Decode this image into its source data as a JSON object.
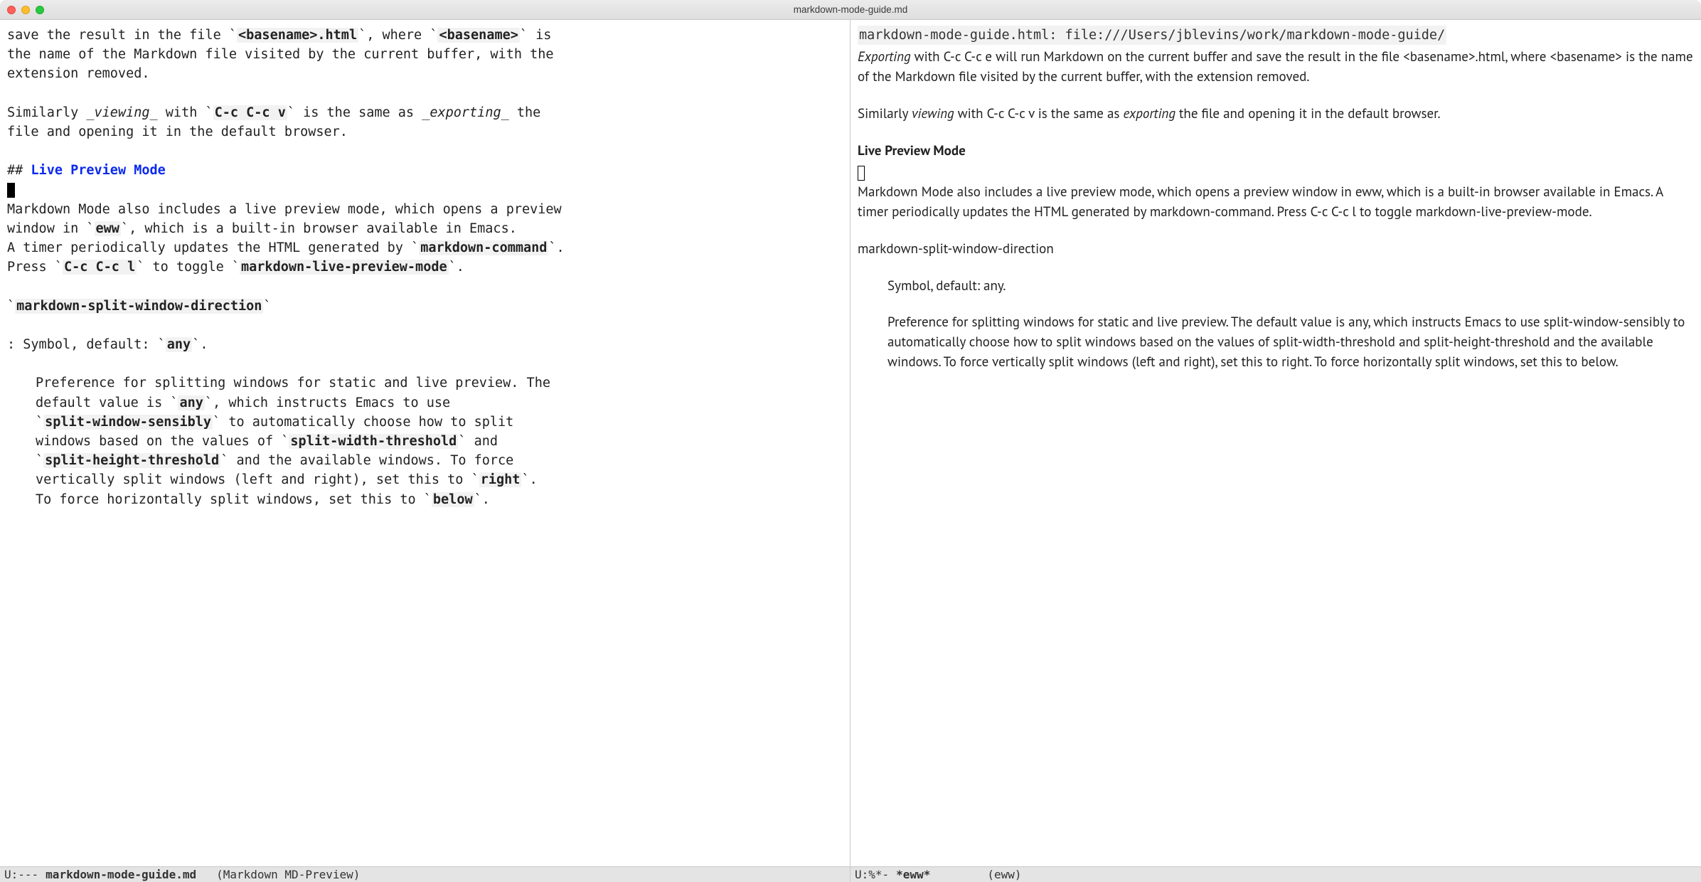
{
  "window": {
    "title": "markdown-mode-guide.md"
  },
  "left": {
    "line1_a": "save the result in the file `",
    "line1_b": "<basename>.html",
    "line1_c": "`, where `",
    "line1_d": "<basename>",
    "line1_e": "` is",
    "line2": "the name of the Markdown file visited by the current buffer, with the",
    "line3": "extension removed.",
    "line5_a": "Similarly ",
    "line5_b": "_viewing_",
    "line5_c": " with `",
    "line5_d": "C-c C-c v",
    "line5_e": "` is the same as ",
    "line5_f": "_exporting_",
    "line5_g": " the",
    "line6": "file and opening it in the default browser.",
    "line8_a": "## ",
    "line8_b": "Live Preview Mode",
    "line10": "Markdown Mode also includes a live preview mode, which opens a preview",
    "line11_a": "window in `",
    "line11_b": "eww",
    "line11_c": "`, which is a built-in browser available in Emacs.",
    "line12_a": "A timer periodically updates the HTML generated by `",
    "line12_b": "markdown-command",
    "line12_c": "`.",
    "line13_a": "Press `",
    "line13_b": "C-c C-c l",
    "line13_c": "` to toggle `",
    "line13_d": "markdown-live-preview-mode",
    "line13_e": "`.",
    "line15_a": "`",
    "line15_b": "markdown-split-window-direction",
    "line15_c": "`",
    "line17_a": ":   Symbol, default: `",
    "line17_b": "any",
    "line17_c": "`.",
    "line19": "Preference for splitting windows for static and live preview.  The",
    "line20_a": "default value is `",
    "line20_b": "any",
    "line20_c": "`, which instructs Emacs to use",
    "line21_a": "`",
    "line21_b": "split-window-sensibly",
    "line21_c": "` to automatically choose how to split",
    "line22_a": "windows based on the values of `",
    "line22_b": "split-width-threshold",
    "line22_c": "` and",
    "line23_a": "`",
    "line23_b": "split-height-threshold",
    "line23_c": "` and the available windows.  To force",
    "line24_a": "vertically split windows (left and right), set this to `",
    "line24_b": "right",
    "line24_c": "`.",
    "line25_a": "To force horizontally split windows, set this to `",
    "line25_b": "below",
    "line25_c": "`."
  },
  "left_modeline": {
    "status": "U:---",
    "buffer_name": "markdown-mode-guide.md",
    "mode": "(Markdown MD-Preview)"
  },
  "right": {
    "url_line": "markdown-mode-guide.html: file:///Users/jblevins/work/markdown-mode-guide/",
    "p1_a": "Exporting",
    "p1_b": " with C-c C-c e will run Markdown on the current buffer and save the result in the file <basename>.html, where <basename> is the name of the Markdown file visited by the current buffer, with the extension removed.",
    "p2_a": "Similarly ",
    "p2_b": "viewing",
    "p2_c": " with C-c C-c v is the same as ",
    "p2_d": "exporting",
    "p2_e": " the file and opening it in the default browser.",
    "h2": "Live Preview Mode",
    "p3": "Markdown Mode also includes a live preview mode, which opens a preview window in eww, which is a built-in browser available in Emacs. A timer periodically updates the HTML generated by markdown-command. Press C-c C-c l to toggle markdown-live-preview-mode.",
    "p4": "markdown-split-window-direction",
    "p5": "Symbol, default: any.",
    "p6": "Preference for splitting windows for static and live preview. The default value is any, which instructs Emacs to use split-window-sensibly to automatically choose how to split windows based on the values of split-width-threshold and split-height-threshold and the available windows. To force vertically split windows (left and right), set this to right. To force horizontally split windows, set this to below."
  },
  "right_modeline": {
    "status": "U:%*-",
    "buffer_name": "*eww*",
    "mode": "(eww)"
  }
}
